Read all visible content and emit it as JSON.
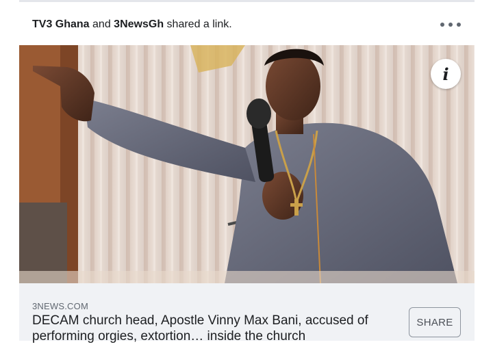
{
  "post": {
    "sharer_1": "TV3 Ghana",
    "conjunction": " and ",
    "sharer_2": "3NewsGh",
    "action": " shared a link.",
    "more_icon": "more-horizontal-icon"
  },
  "photo": {
    "alt_description_icon": "info-icon",
    "info_glyph": "i"
  },
  "link": {
    "domain": "3NEWS.COM",
    "headline": "DECAM church head, Apostle Vinny Max Bani, accused of performing orgies, extortion… inside the church",
    "share_label": "SHARE"
  },
  "colors": {
    "link_box_bg": "#f0f2f5",
    "text_primary": "#1c1e21",
    "text_secondary": "#606770"
  }
}
